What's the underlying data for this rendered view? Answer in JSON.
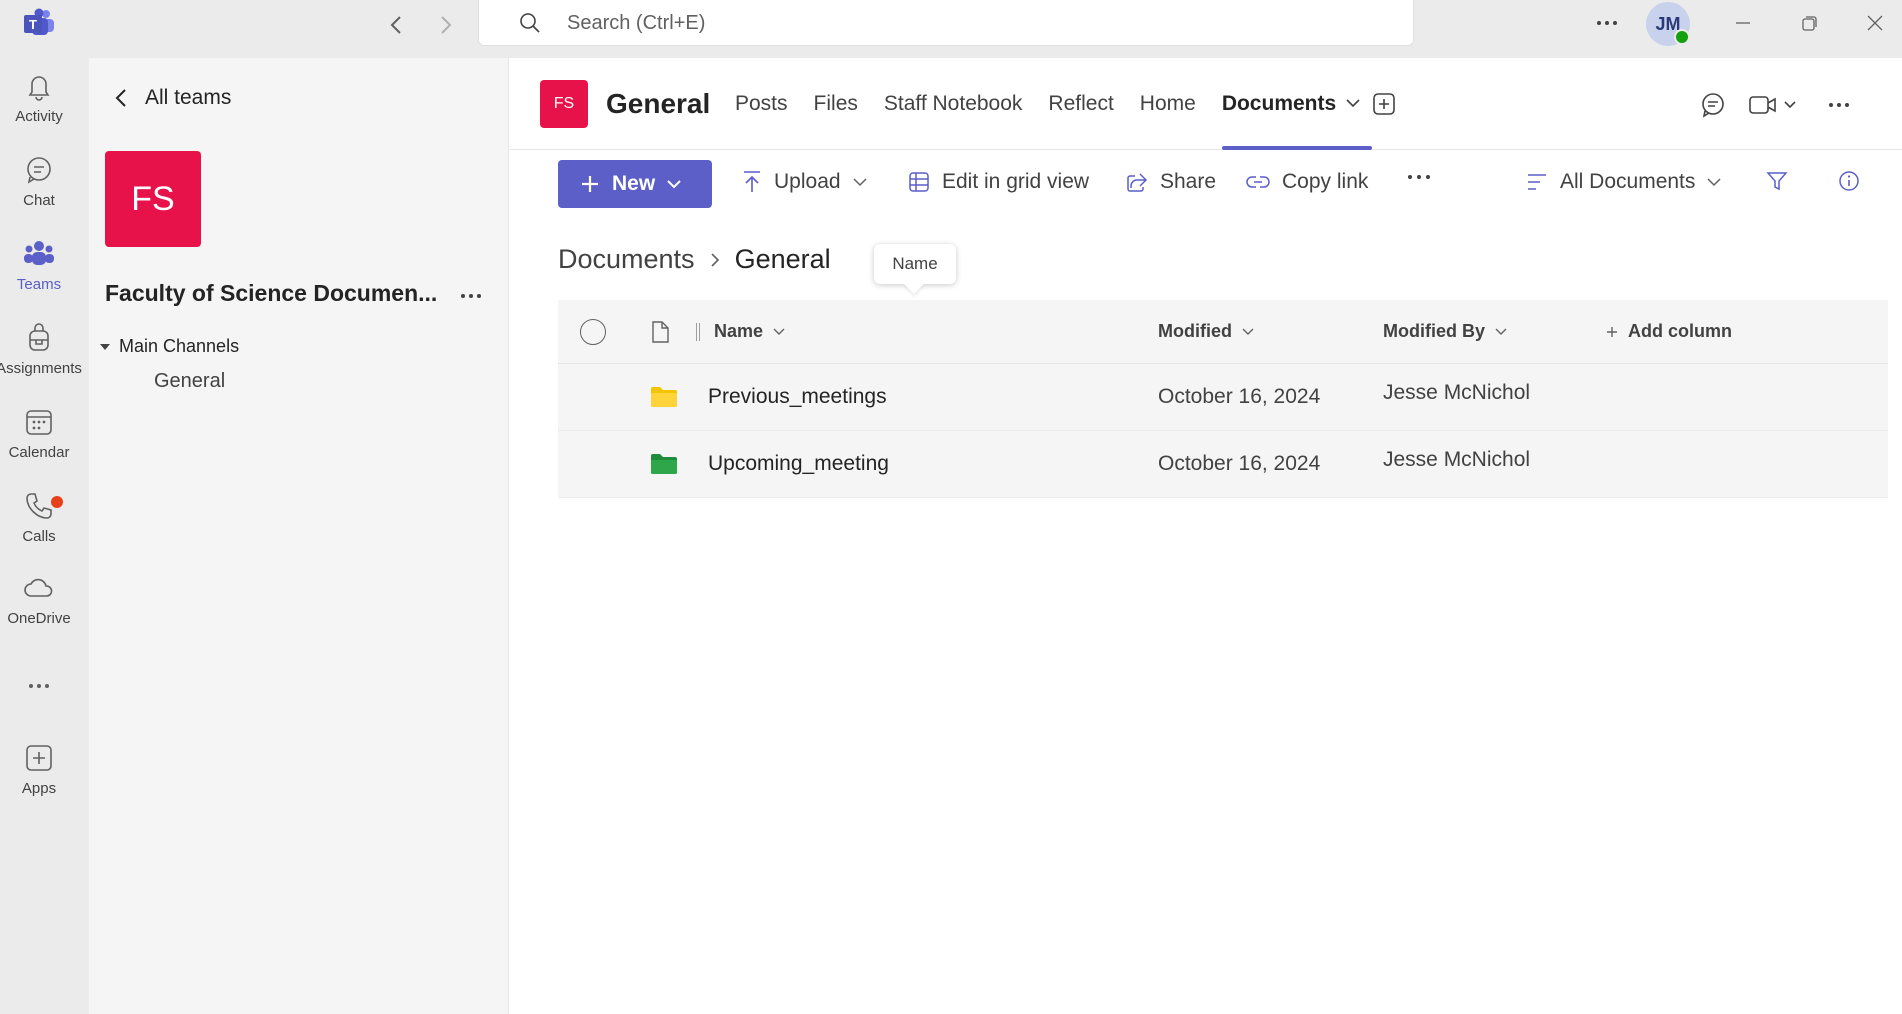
{
  "titlebar": {
    "search_placeholder": "Search (Ctrl+E)",
    "avatar_initials": "JM",
    "presence_color": "#13a10e"
  },
  "rail": {
    "items": [
      {
        "label": "Activity",
        "icon": "bell-icon"
      },
      {
        "label": "Chat",
        "icon": "chat-icon"
      },
      {
        "label": "Teams",
        "icon": "teams-icon",
        "active": true
      },
      {
        "label": "Assignments",
        "icon": "backpack-icon"
      },
      {
        "label": "Calendar",
        "icon": "calendar-icon"
      },
      {
        "label": "Calls",
        "icon": "phone-icon",
        "notification": true
      },
      {
        "label": "OneDrive",
        "icon": "cloud-icon"
      },
      {
        "label": "",
        "icon": "more-icon"
      },
      {
        "label": "Apps",
        "icon": "add-app-icon"
      }
    ],
    "accent": "#5b5fc7"
  },
  "panel": {
    "back_label": "All teams",
    "team_initials": "FS",
    "team_name": "Faculty of Science Documen...",
    "channels_header": "Main Channels",
    "channels": [
      "General"
    ],
    "team_color": "#e8124a"
  },
  "channel": {
    "initials": "FS",
    "title": "General",
    "tabs": [
      "Posts",
      "Files",
      "Staff Notebook",
      "Reflect",
      "Home",
      "Documents"
    ],
    "active_tab": "Documents"
  },
  "toolbar": {
    "new_label": "New",
    "upload_label": "Upload",
    "grid_label": "Edit in grid view",
    "share_label": "Share",
    "copy_link_label": "Copy link",
    "view_label": "All Documents"
  },
  "breadcrumb": {
    "root": "Documents",
    "current": "General"
  },
  "tooltip": "Name",
  "table": {
    "columns": {
      "name": "Name",
      "modified": "Modified",
      "modified_by": "Modified By",
      "add_column": "Add column"
    },
    "rows": [
      {
        "name": "Previous_meetings",
        "modified": "October 16, 2024",
        "modified_by": "Jesse McNichol",
        "folder_color": "#f5c400"
      },
      {
        "name": "Upcoming_meeting",
        "modified": "October 16, 2024",
        "modified_by": "Jesse McNichol",
        "folder_color": "#1f8c3a"
      }
    ]
  }
}
